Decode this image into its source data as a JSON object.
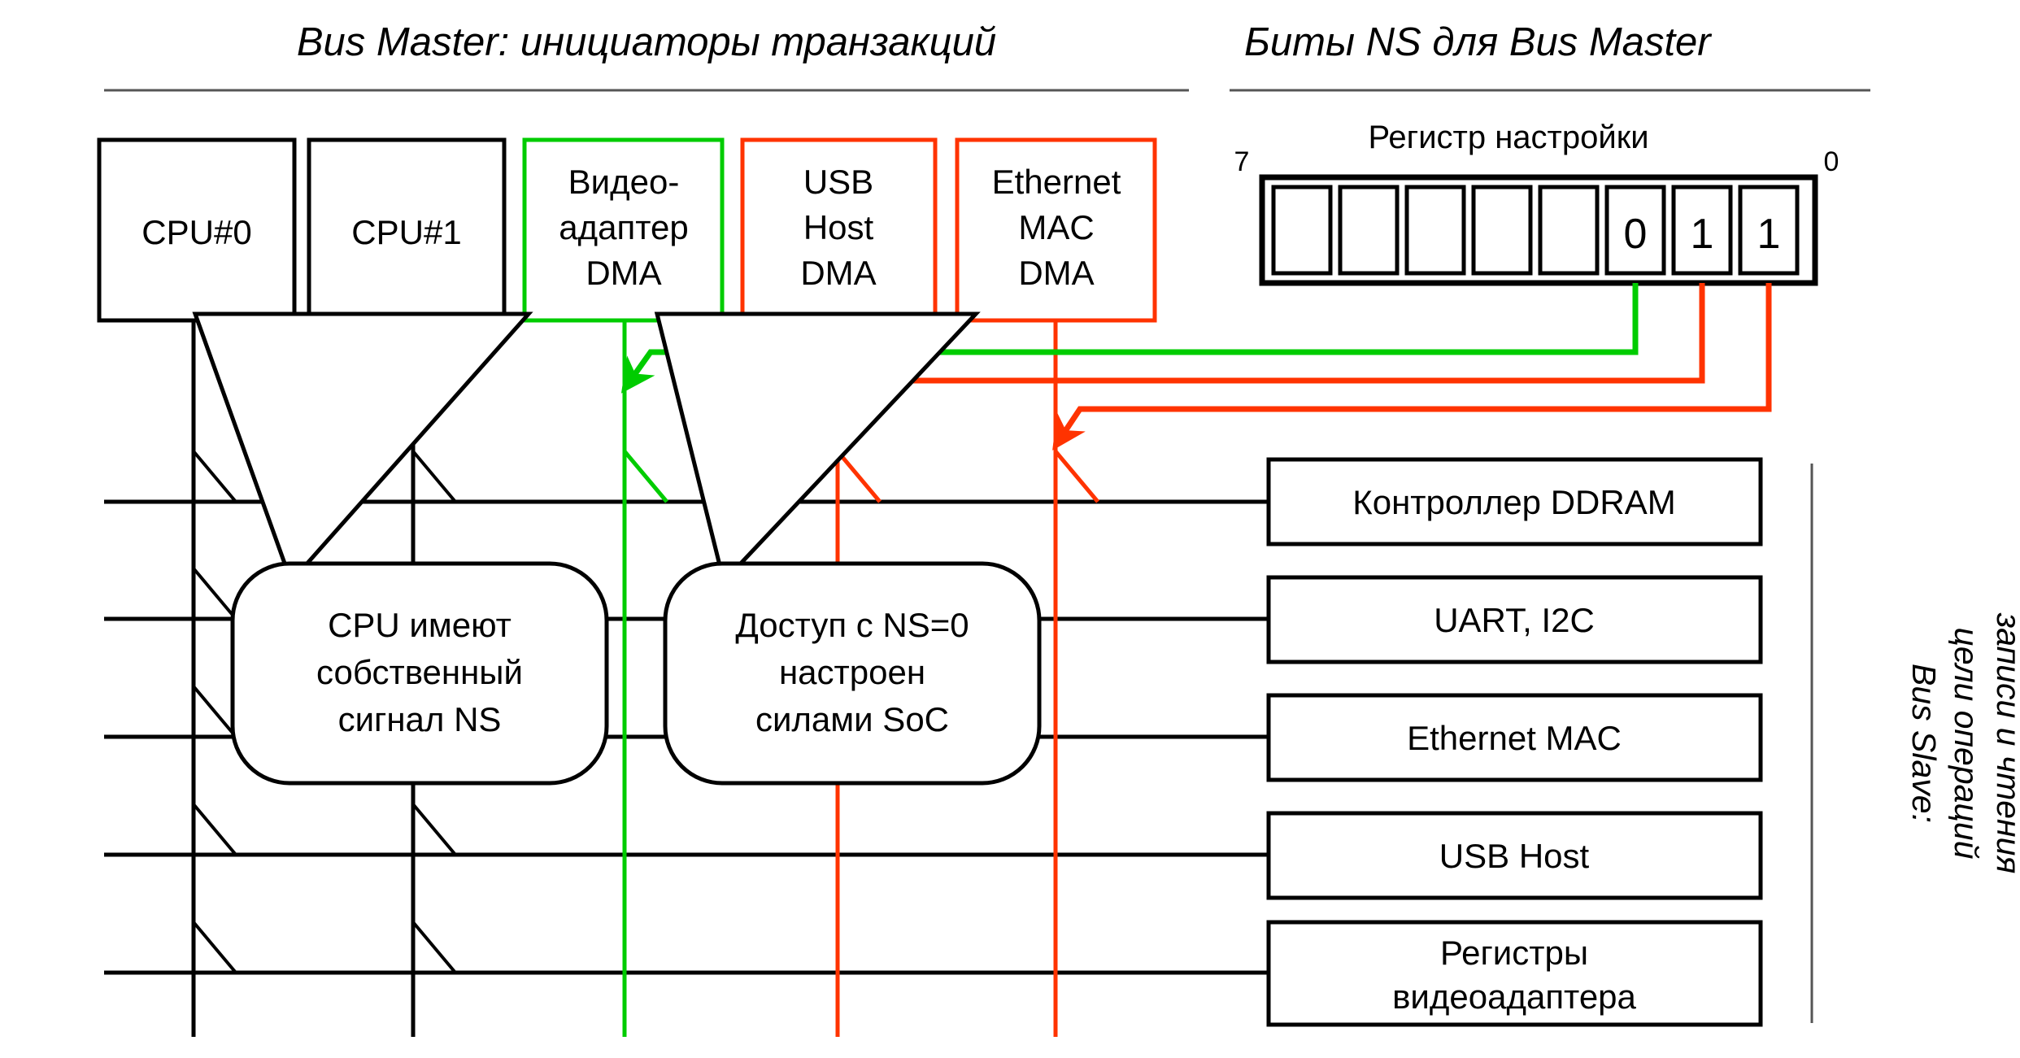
{
  "headers": {
    "masters": "Bus Master: инициаторы транзакций",
    "ns_bits": "Биты NS для Bus Master"
  },
  "masters": [
    {
      "id": "cpu0",
      "label": "CPU#0",
      "color": "#000000"
    },
    {
      "id": "cpu1",
      "label": "CPU#1",
      "color": "#000000"
    },
    {
      "id": "video",
      "label": "Видео-\nадаптер\nDMA",
      "color": "#00cc00"
    },
    {
      "id": "usb",
      "label": "USB\nHost\nDMA",
      "color": "#ff3300"
    },
    {
      "id": "eth",
      "label": "Ethernet\nMAC\nDMA",
      "color": "#ff3300"
    }
  ],
  "master_labels": {
    "cpu0": "CPU#0",
    "cpu1": "CPU#1",
    "video_l1": "Видео-",
    "video_l2": "адаптер",
    "video_l3": "DMA",
    "usb_l1": "USB",
    "usb_l2": "Host",
    "usb_l3": "DMA",
    "eth_l1": "Ethernet",
    "eth_l2": "MAC",
    "eth_l3": "DMA"
  },
  "register": {
    "caption": "Регистр настройки",
    "msb_label": "7",
    "lsb_label": "0",
    "bits": [
      "",
      "",
      "",
      "",
      "",
      "0",
      "1",
      "1"
    ]
  },
  "slaves": [
    {
      "id": "ddram",
      "label": "Контроллер DDRAM"
    },
    {
      "id": "uart",
      "label": "UART, I2C"
    },
    {
      "id": "ethmac",
      "label": "Ethernet MAC"
    },
    {
      "id": "usbhost",
      "label": "USB Host"
    },
    {
      "id": "videoreg",
      "label": "Регистры\nвидеоадаптера"
    }
  ],
  "slave_labels": {
    "ddram": "Контроллер DDRAM",
    "uart": "UART, I2C",
    "ethmac": "Ethernet MAC",
    "usbhost": "USB Host",
    "videoreg_l1": "Регистры",
    "videoreg_l2": "видеоадаптера"
  },
  "callouts": {
    "cpu_ns": {
      "l1": "CPU имеют",
      "l2": "собственный",
      "l3": "сигнал NS"
    },
    "soc_ns": {
      "l1": "Доступ с NS=0",
      "l2": "настроен",
      "l3": "силами SoC"
    }
  },
  "side_label": {
    "l1": "Bus Slave:",
    "l2": "цели операций",
    "l3": "записи и чтения"
  },
  "colors": {
    "green": "#00cc00",
    "red": "#ff3300",
    "black": "#000000",
    "rule": "#555555"
  }
}
